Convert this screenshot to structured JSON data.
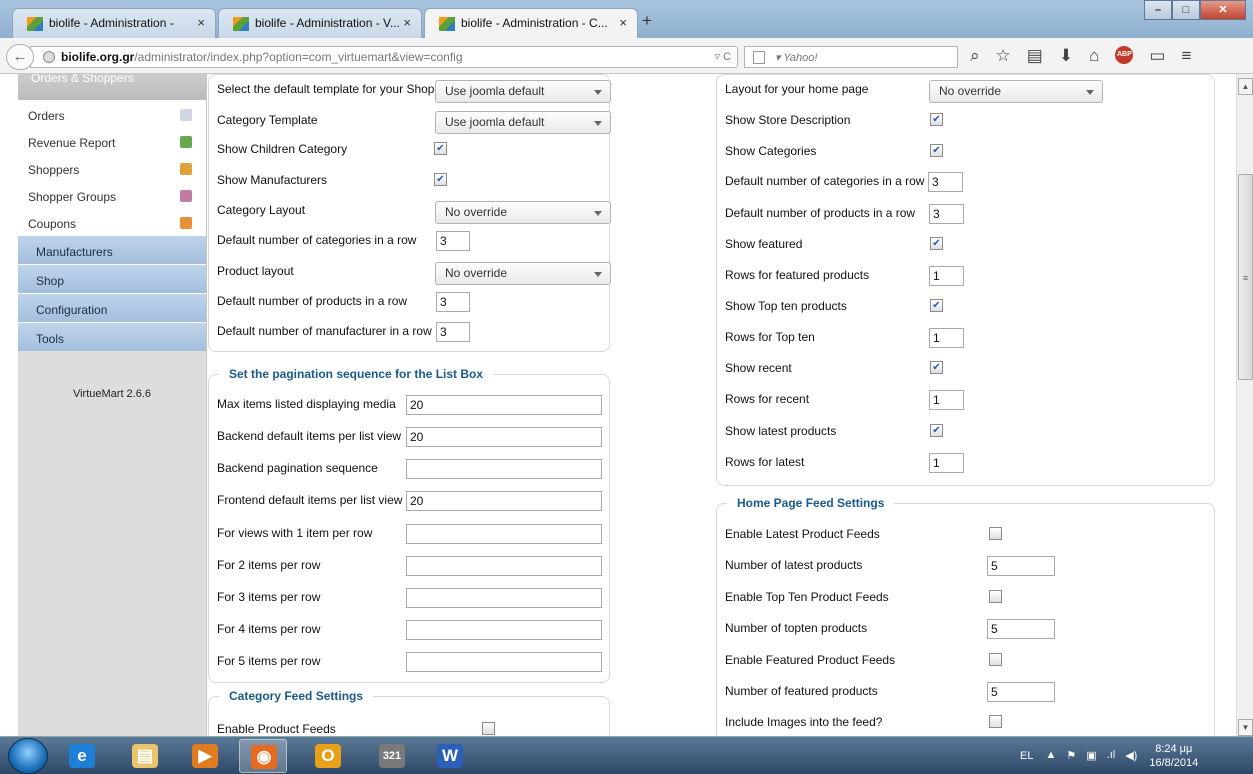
{
  "browser": {
    "tabs": [
      {
        "label": "biolife - Administration -",
        "close": "×",
        "active": false
      },
      {
        "label": "biolife - Administration - V...",
        "close": "×",
        "active": false
      },
      {
        "label": "biolife - Administration - C...",
        "close": "×",
        "active": true
      }
    ],
    "new_tab": "+",
    "url_domain": "biolife.org.gr",
    "url_path": "/administrator/index.php?option=com_virtuemart&view=config",
    "url_controls": "▿ C",
    "search_placeholder": "▾ Yahoo!",
    "toolbar_icons": [
      "search-icon",
      "bookmark-star-icon",
      "reading-list-icon",
      "download-icon",
      "home-icon",
      "adblock-icon",
      "window-icon",
      "menu-icon"
    ],
    "toolbar_glyphs": [
      "⌕",
      "☆",
      "▤",
      "⬇",
      "⌂",
      "ABP",
      "▭",
      "≡"
    ]
  },
  "sidebar": {
    "top_label": "Orders & Shoppers",
    "items": [
      {
        "label": "Orders",
        "icon": "orders-icon",
        "color": "#cfd6de"
      },
      {
        "label": "Revenue Report",
        "icon": "bar-chart-icon",
        "color": "#6aa84f"
      },
      {
        "label": "Shoppers",
        "icon": "shoppers-icon",
        "color": "#e0a23a"
      },
      {
        "label": "Shopper Groups",
        "icon": "shopper-groups-icon",
        "color": "#c27ba0"
      },
      {
        "label": "Coupons",
        "icon": "gift-icon",
        "color": "#e69138"
      }
    ],
    "menus": [
      "Manufacturers",
      "Shop",
      "Configuration",
      "Tools"
    ],
    "version": "VirtueMart 2.6.6"
  },
  "left": {
    "template_rows": [
      {
        "label": "Select the default template for your Shop",
        "type": "select",
        "value": "Use joomla default"
      },
      {
        "label": "Category Template",
        "type": "select",
        "value": "Use joomla default"
      },
      {
        "label": "Show Children Category",
        "type": "check",
        "value": true
      },
      {
        "label": "Show Manufacturers",
        "type": "check",
        "value": true
      },
      {
        "label": "Category Layout",
        "type": "select",
        "value": "No override"
      },
      {
        "label": "Default number of categories in a row",
        "type": "text",
        "value": "3"
      },
      {
        "label": "Product layout",
        "type": "select",
        "value": "No override"
      },
      {
        "label": "Default number of products in a row",
        "type": "text",
        "value": "3"
      },
      {
        "label": "Default number of manufacturer in a row",
        "type": "text",
        "value": "3"
      }
    ],
    "pagination_legend": "Set the pagination sequence for the List Box",
    "pagination_rows": [
      {
        "label": "Max items listed displaying media",
        "value": "20"
      },
      {
        "label": "Backend default items per list view",
        "value": "20"
      },
      {
        "label": "Backend pagination sequence",
        "value": ""
      },
      {
        "label": "Frontend default items per list view",
        "value": "20"
      },
      {
        "label": "For views with 1 item per row",
        "value": ""
      },
      {
        "label": "For 2 items per row",
        "value": ""
      },
      {
        "label": "For 3 items per row",
        "value": ""
      },
      {
        "label": "For 4 items per row",
        "value": ""
      },
      {
        "label": "For 5 items per row",
        "value": ""
      }
    ],
    "category_feed_legend": "Category Feed Settings",
    "category_feed_rows": [
      {
        "label": "Enable Product Feeds",
        "type": "check",
        "value": false
      }
    ]
  },
  "right": {
    "home_rows": [
      {
        "label": "Layout for your home page",
        "type": "select",
        "value": "No override"
      },
      {
        "label": "Show Store Description",
        "type": "check",
        "value": true
      },
      {
        "label": "Show Categories",
        "type": "check",
        "value": true
      },
      {
        "label": "Default number of categories in a row",
        "type": "text",
        "value": "3"
      },
      {
        "label": "Default number of products in a row",
        "type": "text",
        "value": "3"
      },
      {
        "label": "Show featured",
        "type": "check",
        "value": true
      },
      {
        "label": "Rows for featured products",
        "type": "text",
        "value": "1"
      },
      {
        "label": "Show Top ten products",
        "type": "check",
        "value": true
      },
      {
        "label": "Rows for Top ten",
        "type": "text",
        "value": "1"
      },
      {
        "label": "Show recent",
        "type": "check",
        "value": true
      },
      {
        "label": "Rows for recent",
        "type": "text",
        "value": "1"
      },
      {
        "label": "Show latest products",
        "type": "check",
        "value": true
      },
      {
        "label": "Rows for latest",
        "type": "text",
        "value": "1"
      }
    ],
    "feed_legend": "Home Page Feed Settings",
    "feed_rows": [
      {
        "label": "Enable Latest Product Feeds",
        "type": "check",
        "value": false
      },
      {
        "label": "Number of latest products",
        "type": "text",
        "value": "5"
      },
      {
        "label": "Enable Top Ten Product Feeds",
        "type": "check",
        "value": false
      },
      {
        "label": "Number of topten products",
        "type": "text",
        "value": "5"
      },
      {
        "label": "Enable Featured Product Feeds",
        "type": "check",
        "value": false
      },
      {
        "label": "Number of featured products",
        "type": "text",
        "value": "5"
      },
      {
        "label": "Include Images into the feed?",
        "type": "check",
        "value": false
      }
    ]
  },
  "taskbar": {
    "apps": [
      {
        "name": "internet-explorer-icon",
        "glyph": "e",
        "color": "#1e7fd6",
        "active": false
      },
      {
        "name": "file-explorer-icon",
        "glyph": "▤",
        "color": "#e8c46a",
        "active": false
      },
      {
        "name": "media-player-icon",
        "glyph": "▶",
        "color": "#e07b1e",
        "active": false
      },
      {
        "name": "firefox-icon",
        "glyph": "◉",
        "color": "#e66a1f",
        "active": true
      },
      {
        "name": "outlook-icon",
        "glyph": "O",
        "color": "#e8a21a",
        "active": false
      },
      {
        "name": "calendar-icon",
        "glyph": "321",
        "color": "#7a7a7a",
        "active": false
      },
      {
        "name": "word-icon",
        "glyph": "W",
        "color": "#2b5fb8",
        "active": false
      }
    ],
    "language": "EL",
    "tray_icons": [
      "▲",
      "⚑",
      "▣",
      ".ıl",
      "◀)"
    ],
    "time": "8:24 μμ",
    "date": "16/8/2014"
  }
}
